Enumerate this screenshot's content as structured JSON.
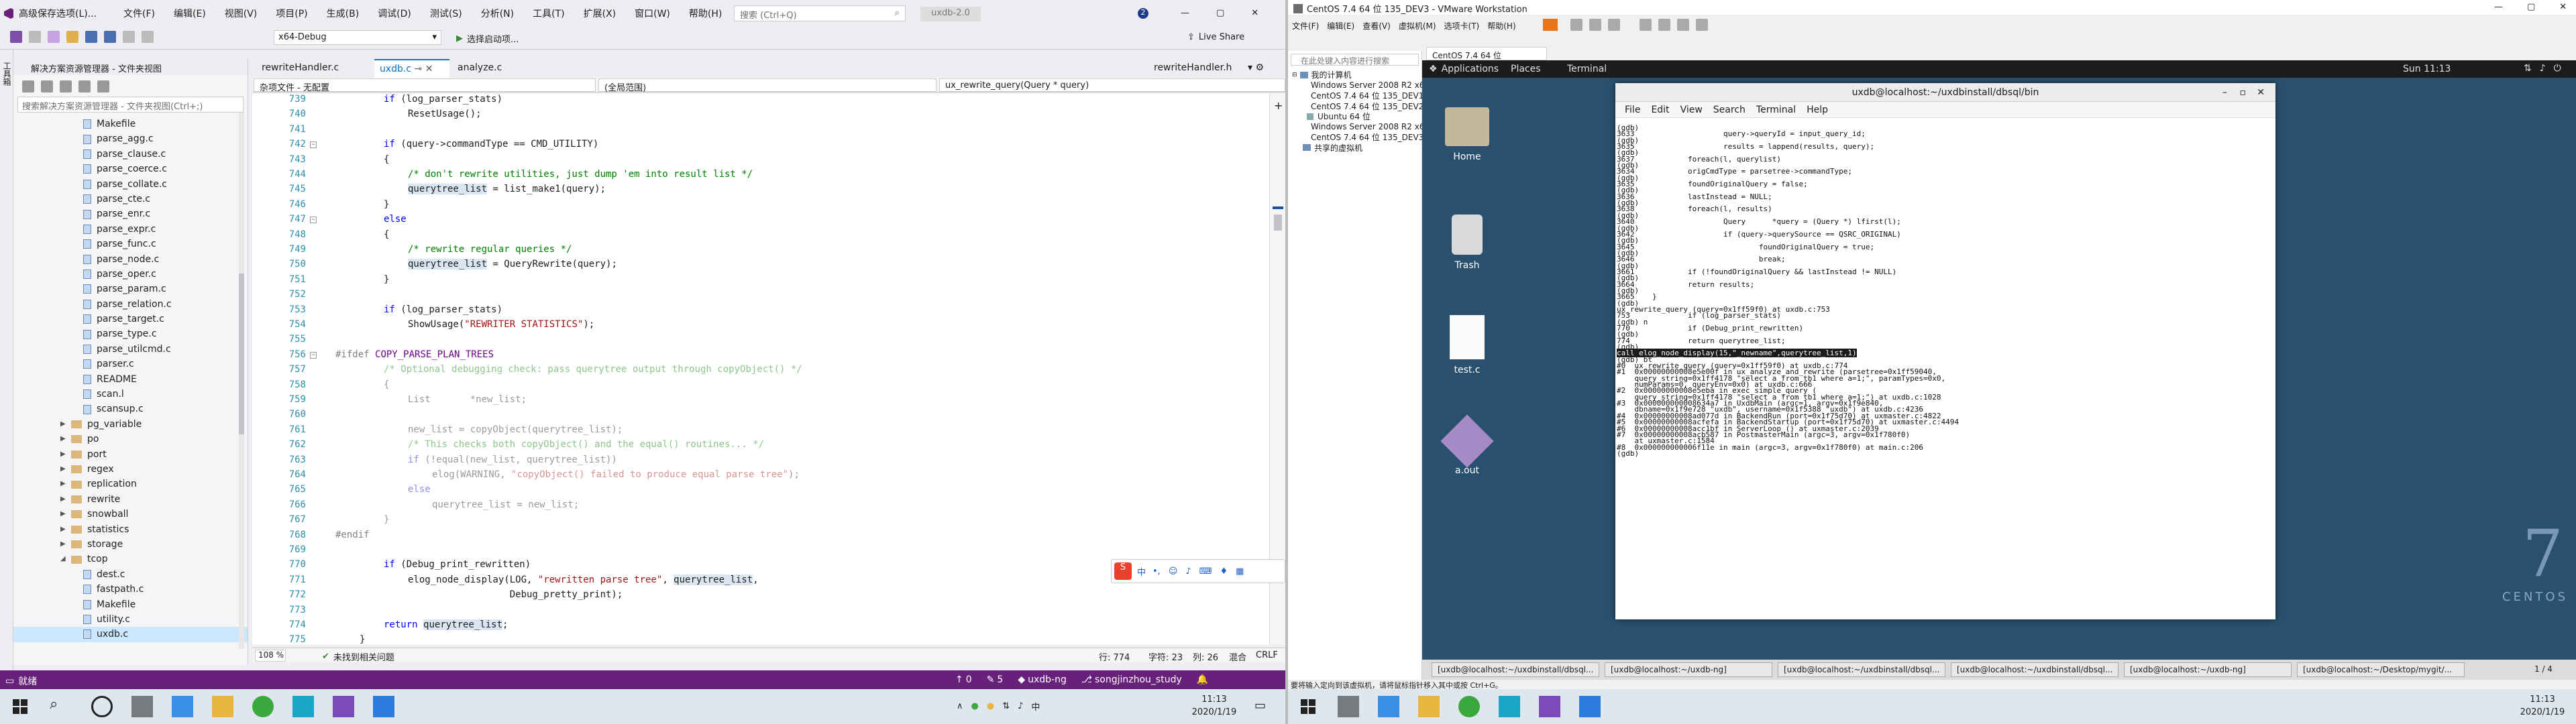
{
  "vs": {
    "title": "高级保存选项(L)...",
    "menu": [
      "文件(F)",
      "编辑(E)",
      "视图(V)",
      "项目(P)",
      "生成(B)",
      "调试(D)",
      "测试(S)",
      "分析(N)",
      "工具(T)",
      "扩展(X)",
      "窗口(W)",
      "帮助(H)"
    ],
    "search_placeholder": "搜索 (Ctrl+Q)",
    "solution_name": "uxdb-2.0",
    "config": "x64-Debug",
    "run": "选择启动项...",
    "live_share": "Live Share",
    "notif": "2",
    "se_title": "解决方案资源管理器 - 文件夹视图",
    "se_search": "搜索解决方案资源管理器 - 文件夹视图(Ctrl+;)",
    "tree": [
      {
        "t": "Makefile",
        "k": "file",
        "d": 3
      },
      {
        "t": "parse_agg.c",
        "k": "file",
        "d": 3
      },
      {
        "t": "parse_clause.c",
        "k": "file",
        "d": 3
      },
      {
        "t": "parse_coerce.c",
        "k": "file",
        "d": 3
      },
      {
        "t": "parse_collate.c",
        "k": "file",
        "d": 3
      },
      {
        "t": "parse_cte.c",
        "k": "file",
        "d": 3
      },
      {
        "t": "parse_enr.c",
        "k": "file",
        "d": 3
      },
      {
        "t": "parse_expr.c",
        "k": "file",
        "d": 3
      },
      {
        "t": "parse_func.c",
        "k": "file",
        "d": 3
      },
      {
        "t": "parse_node.c",
        "k": "file",
        "d": 3
      },
      {
        "t": "parse_oper.c",
        "k": "file",
        "d": 3
      },
      {
        "t": "parse_param.c",
        "k": "file",
        "d": 3
      },
      {
        "t": "parse_relation.c",
        "k": "file",
        "d": 3
      },
      {
        "t": "parse_target.c",
        "k": "file",
        "d": 3
      },
      {
        "t": "parse_type.c",
        "k": "file",
        "d": 3
      },
      {
        "t": "parse_utilcmd.c",
        "k": "file",
        "d": 3
      },
      {
        "t": "parser.c",
        "k": "file",
        "d": 3
      },
      {
        "t": "README",
        "k": "file",
        "d": 3
      },
      {
        "t": "scan.l",
        "k": "file",
        "d": 3
      },
      {
        "t": "scansup.c",
        "k": "file",
        "d": 3
      },
      {
        "t": "pg_variable",
        "k": "folder",
        "d": 2
      },
      {
        "t": "po",
        "k": "folder",
        "d": 2
      },
      {
        "t": "port",
        "k": "folder",
        "d": 2
      },
      {
        "t": "regex",
        "k": "folder",
        "d": 2
      },
      {
        "t": "replication",
        "k": "folder",
        "d": 2
      },
      {
        "t": "rewrite",
        "k": "folder",
        "d": 2
      },
      {
        "t": "snowball",
        "k": "folder",
        "d": 2
      },
      {
        "t": "statistics",
        "k": "folder",
        "d": 2
      },
      {
        "t": "storage",
        "k": "folder",
        "d": 2
      },
      {
        "t": "tcop",
        "k": "folder-open",
        "d": 2
      },
      {
        "t": "dest.c",
        "k": "file",
        "d": 3
      },
      {
        "t": "fastpath.c",
        "k": "file",
        "d": 3
      },
      {
        "t": "Makefile",
        "k": "file",
        "d": 3
      },
      {
        "t": "utility.c",
        "k": "file",
        "d": 3
      },
      {
        "t": "uxdb.c",
        "k": "file",
        "d": 3,
        "sel": true
      }
    ],
    "tabs": [
      "rewriteHandler.c",
      "uxdb.c",
      "analyze.c"
    ],
    "tab_right": "rewriteHandler.h",
    "nav": [
      "杂项文件 - 无配置",
      "(全局范围)",
      "ux_rewrite_query(Query * query)"
    ],
    "code": [
      {
        "n": "739",
        "h": "<span class=\"kw\">if</span> (log_parser_stats)",
        "i": 2
      },
      {
        "n": "740",
        "h": "ResetUsage();",
        "i": 3
      },
      {
        "n": "741",
        "h": "",
        "i": 0
      },
      {
        "n": "742",
        "h": "<span class=\"kw\">if</span> (query-&gt;commandType == CMD_UTILITY)",
        "i": 2
      },
      {
        "n": "743",
        "h": "{",
        "i": 2
      },
      {
        "n": "744",
        "h": "<span class=\"cm\">/* don't rewrite utilities, just dump 'em into result list */</span>",
        "i": 3
      },
      {
        "n": "745",
        "h": "<span class=\"hl\">querytree_list</span> = list_make1(query);",
        "i": 3
      },
      {
        "n": "746",
        "h": "}",
        "i": 2
      },
      {
        "n": "747",
        "h": "<span class=\"kw\">else</span>",
        "i": 2
      },
      {
        "n": "748",
        "h": "{",
        "i": 2
      },
      {
        "n": "749",
        "h": "<span class=\"cm\">/* rewrite regular queries */</span>",
        "i": 3
      },
      {
        "n": "750",
        "h": "<span class=\"hl\">querytree_list</span> = QueryRewrite(query);",
        "i": 3
      },
      {
        "n": "751",
        "h": "}",
        "i": 2
      },
      {
        "n": "752",
        "h": "",
        "i": 0
      },
      {
        "n": "753",
        "h": "<span class=\"kw\">if</span> (log_parser_stats)",
        "i": 2
      },
      {
        "n": "754",
        "h": "ShowUsage(<span class=\"st\">\"REWRITER STATISTICS\"</span>);",
        "i": 3
      },
      {
        "n": "755",
        "h": "",
        "i": 0
      },
      {
        "n": "756",
        "h": "<span class=\"pp\">#ifdef</span> <span class=\"mac\">COPY_PARSE_PLAN_TREES</span>",
        "i": 0
      },
      {
        "n": "757",
        "h": "<span class=\"dim\"><span class=\"cm\">/* Optional debugging check: pass querytree output through copyObject() */</span></span>",
        "i": 2
      },
      {
        "n": "758",
        "h": "<span class=\"dim\">{</span>",
        "i": 2
      },
      {
        "n": "759",
        "h": "<span class=\"dim\">List       *new_list;</span>",
        "i": 3
      },
      {
        "n": "760",
        "h": "",
        "i": 0
      },
      {
        "n": "761",
        "h": "<span class=\"dim\">new_list = copyObject(querytree_list);</span>",
        "i": 3
      },
      {
        "n": "762",
        "h": "<span class=\"dim\"><span class=\"cm\">/* This checks both copyObject() and the equal() routines... */</span></span>",
        "i": 3
      },
      {
        "n": "763",
        "h": "<span class=\"dim\"><span class=\"kw\">if</span> (!equal(new_list, querytree_list))</span>",
        "i": 3
      },
      {
        "n": "764",
        "h": "<span class=\"dim\">elog(WARNING, <span class=\"st\">\"copyObject() failed to produce equal parse tree\"</span>);</span>",
        "i": 4
      },
      {
        "n": "765",
        "h": "<span class=\"dim\"><span class=\"kw\">else</span></span>",
        "i": 3
      },
      {
        "n": "766",
        "h": "<span class=\"dim\">querytree_list = new_list;</span>",
        "i": 4
      },
      {
        "n": "767",
        "h": "<span class=\"dim\">}</span>",
        "i": 2
      },
      {
        "n": "768",
        "h": "<span class=\"pp\">#endif</span>",
        "i": 0
      },
      {
        "n": "769",
        "h": "",
        "i": 0
      },
      {
        "n": "770",
        "h": "<span class=\"kw\">if</span> (Debug_print_rewritten)",
        "i": 2
      },
      {
        "n": "771",
        "h": "elog_node_display(LOG, <span class=\"st\">\"rewritten parse tree\"</span>, <span class=\"hl\">querytree_list</span>,",
        "i": 3
      },
      {
        "n": "772",
        "h": "                  Debug_pretty_print);",
        "i": 3
      },
      {
        "n": "773",
        "h": "",
        "i": 0
      },
      {
        "n": "774",
        "h": "<span class=\"kw\">return</span> <span class=\"hl\">querytree_list</span>;",
        "i": 2
      },
      {
        "n": "775",
        "h": "}",
        "i": 1
      },
      {
        "n": "776",
        "h": "",
        "i": 0
      },
      {
        "n": "777",
        "h": "",
        "i": 0
      }
    ],
    "zoom": "108 %",
    "no_issues": "未找到相关问题",
    "cursor": {
      "line": "行: 774",
      "char": "字符: 23",
      "col": "列: 26",
      "ins": "混合",
      "eol": "CRLF"
    },
    "status": {
      "ready": "就绪",
      "up": "0",
      "pencil": "5",
      "repo": "uxdb-ng",
      "branch": "songjinzhou_study"
    },
    "ime_label": "中"
  },
  "vmw": {
    "title": "CentOS 7.4 64 位 135_DEV3 - VMware Workstation",
    "menu": [
      "文件(F)",
      "编辑(E)",
      "查看(V)",
      "虚拟机(M)",
      "选项卡(T)",
      "帮助(H)"
    ],
    "lib_search": "在此处键入内容进行搜索",
    "lib_root": "我的计算机",
    "lib_items": [
      "Windows Server 2008 R2 x64_datacenter",
      "CentOS 7.4 64 位 135_DEV1",
      "CentOS 7.4 64 位 135_DEV2",
      "Ubuntu 64 位",
      "Windows Server 2008 R2 x64_datacenter2",
      "CentOS 7.4 64 位 135_DEV3"
    ],
    "lib_shared": "共享的虚拟机",
    "vm_tab": "CentOS 7.4 64 位 135_DEV3",
    "gnome": {
      "apps": "Applications",
      "places": "Places",
      "terminal": "Terminal",
      "clock": "Sun 11:13"
    },
    "desktop": [
      "Home",
      "Trash",
      "test.c",
      "a.out"
    ],
    "brand": "CENTOS",
    "brand_num": "7",
    "term": {
      "title": "uxdb@localhost:~/uxdbinstall/dbsql/bin",
      "menu": [
        "File",
        "Edit",
        "View",
        "Search",
        "Terminal",
        "Help"
      ],
      "lines": [
        "(gdb)",
        "3633\t\t\tquery->queryId = input_query_id;",
        "(gdb)",
        "3635\t\t\tresults = lappend(results, query);",
        "(gdb)",
        "3637\t\tforeach(l, querylist)",
        "(gdb)",
        "3634\t\torigCmdType = parsetree->commandType;",
        "(gdb)",
        "3635\t\tfoundOriginalQuery = false;",
        "(gdb)",
        "3636\t\tlastInstead = NULL;",
        "(gdb)",
        "3638\t\tforeach(l, results)",
        "(gdb)",
        "3640\t\t\tQuery\t   *query = (Query *) lfirst(l);",
        "(gdb)",
        "3642\t\t\tif (query->querySource == QSRC_ORIGINAL)",
        "(gdb)",
        "3645\t\t\t\tfoundOriginalQuery = true;",
        "(gdb)",
        "3646\t\t\t\tbreak;",
        "(gdb)",
        "3661\t\tif (!foundOriginalQuery && lastInstead != NULL)",
        "(gdb)",
        "3664\t\treturn results;",
        "(gdb)",
        "3665\t}",
        "(gdb)",
        "ux_rewrite_query (query=0x1ff59f0) at uxdb.c:753",
        "753\t\tif (log_parser_stats)",
        "(gdb) n",
        "770\t\tif (Debug_print_rewritten)",
        "(gdb)",
        "774\t\treturn querytree_list;",
        "(gdb) "
      ],
      "sel_line": "call elog_node_display(15,\"_newname\",querytree_list,1)",
      "lines2": [
        "(gdb) bt",
        "#0  ux_rewrite_query (query=0x1ff59f0) at uxdb.c:774",
        "#1  0x00000000008e5e00f in ux_analyze_and_rewrite (parsetree=0x1ff59040,",
        "    query_string=0x1ff4178 \"select a from tb1 where a=1;\", paramTypes=0x0,",
        "    numParams=0, queryEnv=0x0) at uxdb.c:666",
        "#2  0x00000000008e5eba in exec_simple_query (",
        "    query_string=0x1ff4178 \"select a from tb1 where a=1;\") at uxdb.c:1028",
        "#3  0x000000000008634a7 in UxdbMain (argc=1, argv=0x1f9e840,",
        "    dbname=0x1f9e728 \"uxdb\", username=0x1f5388 \"uxdb\") at uxdb.c:4236",
        "#4  0x00000000008ad077d in BackendRun (port=0x1f75d70) at uxmaster.c:4822",
        "#5  0x00000000008acfefa in BackendStartup (port=0x1f75d70) at uxmaster.c:4494",
        "#6  0x00000000008acc1bf in ServerLoop () at uxmaster.c:2039",
        "#7  0x00000000008acb587 in PostmasterMain (argc=3, argv=0x1f780f0)",
        "    at uxmaster.c:1584",
        "#8  0x000000000006f11e in main (argc=3, argv=0x1f780f0) at main.c:206",
        "(gdb) "
      ]
    },
    "guest_tasks": [
      "[uxdb@localhost:~/uxdbinstall/dbsql...",
      "[uxdb@localhost:~/uxdb-ng]",
      "[uxdb@localhost:~/uxdbinstall/dbsql...",
      "[uxdb@localhost:~/uxdbinstall/dbsql...",
      "[uxdb@localhost:~/uxdb-ng]",
      "[uxdb@localhost:~/Desktop/mygit/...",
      "1 / 4"
    ],
    "status": "要将输入定向到该虚拟机，请将鼠标指针移入其中或按 Ctrl+G。"
  },
  "taskbar1": {
    "time": "11:13",
    "date": "2020/1/19"
  },
  "taskbar2": {
    "time": "11:13",
    "date": "2020/1/19"
  }
}
